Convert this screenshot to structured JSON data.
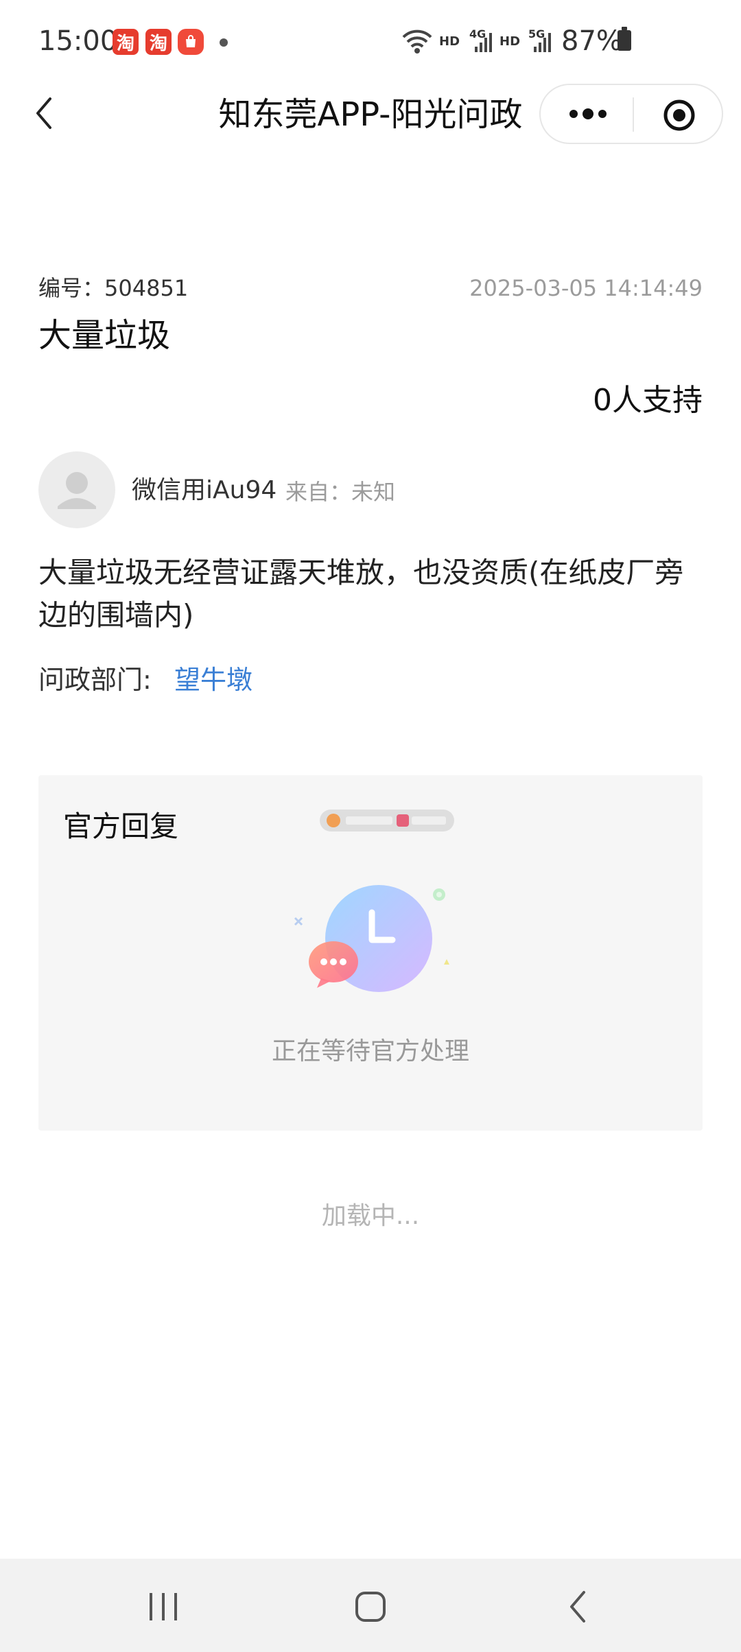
{
  "status_bar": {
    "time": "15:00",
    "app_badges": [
      "淘",
      "淘"
    ],
    "wifi_label": "HD",
    "network_1": "4G",
    "network_1_label": "HD",
    "network_2": "5G",
    "battery": "87%"
  },
  "header": {
    "title": "知东莞APP-阳光问政"
  },
  "post": {
    "id_label": "编号：",
    "id_value": "504851",
    "datetime": "2025-03-05 14:14:49",
    "title": "大量垃圾",
    "support_text": "0人支持",
    "author": "微信用iAu94",
    "from_label": "来自：",
    "from_value": "未知",
    "content": "大量垃圾无经营证露天堆放，也没资质(在纸皮厂旁边的围墙内)",
    "dept_label": "问政部门:",
    "dept_value": "望牛墩"
  },
  "reply": {
    "title": "官方回复",
    "waiting_text": "正在等待官方处理"
  },
  "footer": {
    "loading_text": "加载中..."
  },
  "icons": {
    "back": "chevron-left-icon",
    "more": "more-dots-icon",
    "target": "target-icon",
    "recent": "recent-apps-icon",
    "home": "home-icon",
    "nav_back": "nav-back-icon"
  },
  "colors": {
    "accent_link": "#3a7fd5",
    "badge_red": "#e63c2e",
    "card_bg": "#f6f6f6"
  }
}
